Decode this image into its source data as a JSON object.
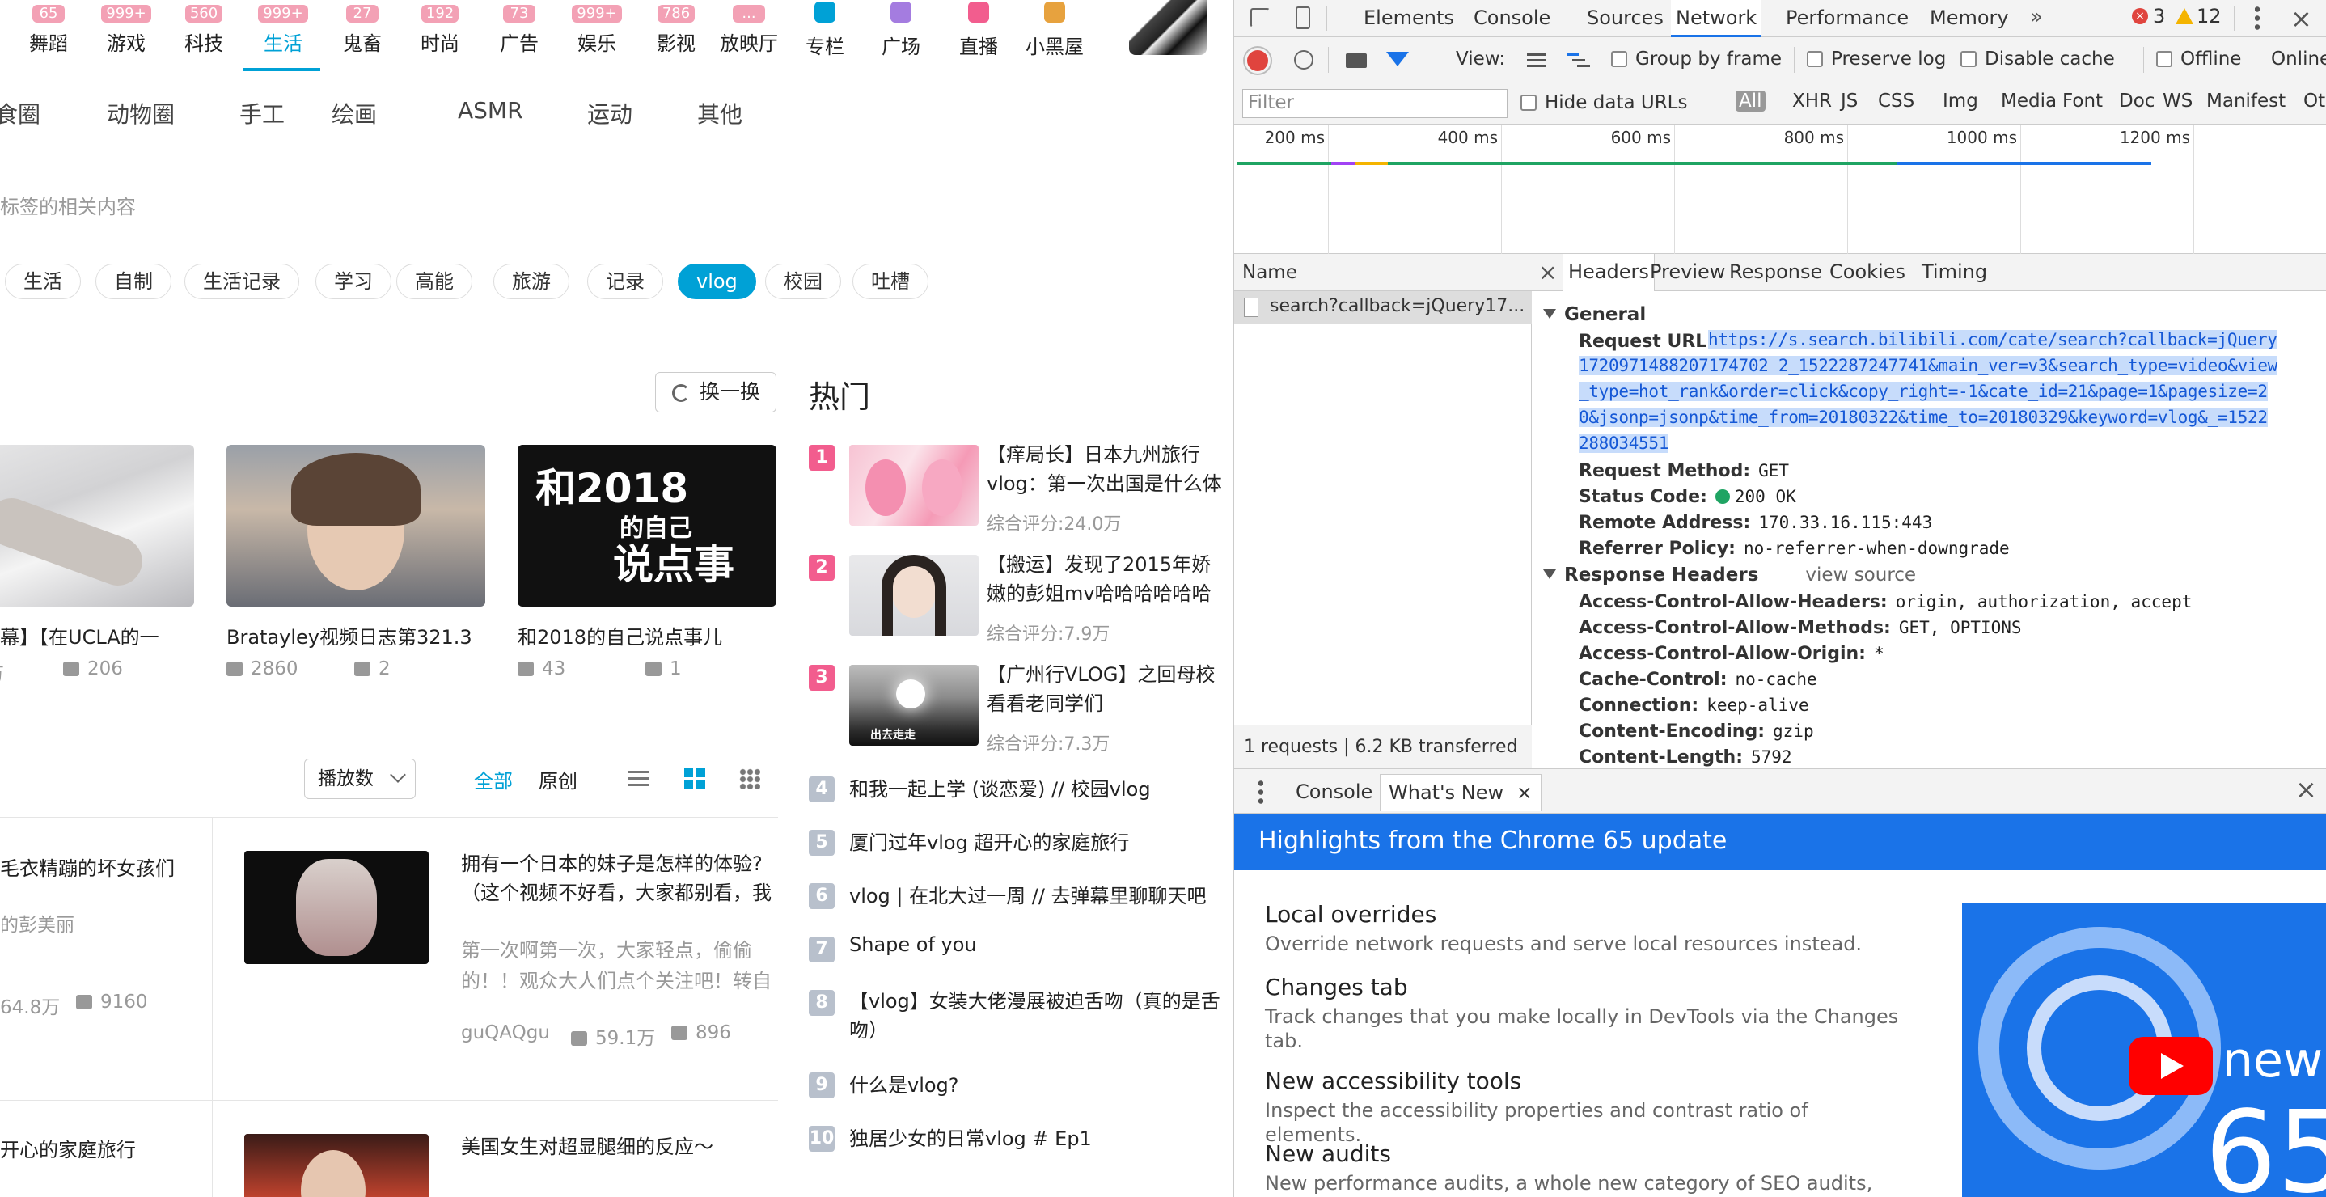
{
  "nav": {
    "items": [
      {
        "count": "65",
        "label": "舞蹈"
      },
      {
        "count": "999+",
        "label": "游戏"
      },
      {
        "count": "560",
        "label": "科技"
      },
      {
        "count": "999+",
        "label": "生活",
        "active": true
      },
      {
        "count": "27",
        "label": "鬼畜"
      },
      {
        "count": "192",
        "label": "时尚"
      },
      {
        "count": "73",
        "label": "广告"
      },
      {
        "count": "999+",
        "label": "娱乐"
      },
      {
        "count": "786",
        "label": "影视"
      },
      {
        "count": "...",
        "label": "放映厅"
      }
    ],
    "icon_items": [
      {
        "label": "专栏",
        "icon": "column-icon",
        "color": "#00a1d6"
      },
      {
        "label": "广场",
        "icon": "square-icon",
        "color": "#a47ce0"
      },
      {
        "label": "直播",
        "icon": "live-icon",
        "color": "#f25d8e"
      },
      {
        "label": "小黑屋",
        "icon": "blackroom-icon",
        "color": "#e7a23e"
      }
    ]
  },
  "subcategories": [
    "食圈",
    "动物圈",
    "手工",
    "绘画",
    "ASMR",
    "运动",
    "其他"
  ],
  "tag_note": "标签的相关内容",
  "tags": [
    {
      "label": "生活"
    },
    {
      "label": "自制"
    },
    {
      "label": "生活记录"
    },
    {
      "label": "学习"
    },
    {
      "label": "高能"
    },
    {
      "label": "旅游"
    },
    {
      "label": "记录"
    },
    {
      "label": "vlog",
      "active": true
    },
    {
      "label": "校园"
    },
    {
      "label": "吐槽"
    }
  ],
  "refresh_label": "换一换",
  "cards": [
    {
      "title": "字幕】【在UCLA的一",
      "plays": "万",
      "danmaku": "206"
    },
    {
      "title": "Bratayley视频日志第321.3",
      "plays": "2860",
      "danmaku": "2"
    },
    {
      "title": "和2018的自己说点事儿",
      "plays": "43",
      "danmaku": "1",
      "thumb_lines": [
        "和2018",
        "的自己",
        "说点事"
      ]
    }
  ],
  "hot": {
    "title": "热门",
    "score_label": "综合评分:",
    "top": [
      {
        "rank": "1",
        "title": "【痒局长】日本九州旅行vlog：第一次出国是什么体",
        "score": "24.0万"
      },
      {
        "rank": "2",
        "title": "【搬运】发现了2015年娇嫩的彭姐mv哈哈哈哈哈哈",
        "score": "7.9万"
      },
      {
        "rank": "3",
        "title": "【广州行VLOG】之回母校看看老同学们",
        "score": "7.3万",
        "thumb_caption": "出去走走"
      }
    ],
    "rest": [
      {
        "rank": "4",
        "title": "和我一起上学 (谈恋爱) // 校园vlog"
      },
      {
        "rank": "5",
        "title": "厦门过年vlog 超开心的家庭旅行"
      },
      {
        "rank": "6",
        "title": "vlog | 在北大过一周 // 去弹幕里聊聊天吧"
      },
      {
        "rank": "7",
        "title": "Shape of you"
      },
      {
        "rank": "8",
        "title": "【vlog】女装大佬漫展被迫舌吻（真的是舌吻）"
      },
      {
        "rank": "9",
        "title": "什么是vlog?"
      },
      {
        "rank": "10",
        "title": "独居少女的日常vlog # Ep1"
      }
    ]
  },
  "sort": {
    "select": "播放数",
    "all": "全部",
    "original": "原创"
  },
  "list": [
    {
      "left_title": "毛衣精蹦的坏女孩们",
      "left_author": "的彭美丽",
      "left_plays": "64.8万",
      "left_danmaku": "9160",
      "title": "拥有一个日本的妹子是怎样的体验?（这个视频不好看，大家都别看，我",
      "desc": "第一次啊第一次，大家轻点，偷偷的！！观众大人们点个关注吧！转自",
      "author": "guQAQgu",
      "plays": "59.1万",
      "danmaku": "896"
    },
    {
      "left_title": "开心的家庭旅行",
      "title": "美国女生对超显腿细的反应～"
    }
  ],
  "devtools": {
    "tabs": [
      "Elements",
      "Console",
      "Sources",
      "Network",
      "Performance",
      "Memory"
    ],
    "active_tab": "Network",
    "errors": "3",
    "warnings": "12",
    "toolbar": {
      "view_label": "View:",
      "group_by_frame": "Group by frame",
      "preserve_log": "Preserve log",
      "disable_cache": "Disable cache",
      "offline": "Offline",
      "online": "Online"
    },
    "filter": {
      "placeholder": "Filter",
      "hide_data_urls": "Hide data URLs",
      "types": [
        "All",
        "XHR",
        "JS",
        "CSS",
        "Img",
        "Media",
        "Font",
        "Doc",
        "WS",
        "Manifest",
        "Other"
      ]
    },
    "timeline": [
      "200 ms",
      "400 ms",
      "600 ms",
      "800 ms",
      "1000 ms",
      "1200 ms"
    ],
    "name_header": "Name",
    "request_name": "search?callback=jQuery17...",
    "summary": "1 requests | 6.2 KB transferred",
    "detail_tabs": [
      "Headers",
      "Preview",
      "Response",
      "Cookies",
      "Timing"
    ],
    "general_title": "General",
    "request_url_label": "Request URL:",
    "request_url": "https://s.search.bilibili.com/cate/search?callback=jQuery1720971488207174702 2_1522287247741&main_ver=v3&search_type=video&view_type=hot_rank&order=click&copy_right=-1&cate_id=21&page=1&pagesize=20&jsonp=jsonp&time_from=20180322&time_to=20180329&keyword=vlog&_=1522288034551",
    "url_lines": [
      "https://s.search.bilibili.com/cate/search?callback=jQuery",
      "1720971488207174702 2_1522287247741&main_ver=v3&search_type=video&view",
      "_type=hot_rank&order=click&copy_right=-1&cate_id=21&page=1&pagesize=2",
      "0&jsonp=jsonp&time_from=20180322&time_to=20180329&keyword=vlog&_=1522",
      "288034551"
    ],
    "general": [
      {
        "k": "Request Method:",
        "v": "GET"
      },
      {
        "k": "Status Code:",
        "v": "200 OK"
      },
      {
        "k": "Remote Address:",
        "v": "170.33.16.115:443"
      },
      {
        "k": "Referrer Policy:",
        "v": "no-referrer-when-downgrade"
      }
    ],
    "response_headers_title": "Response Headers",
    "view_source": "view source",
    "response_headers": [
      {
        "k": "Access-Control-Allow-Headers:",
        "v": "origin, authorization, accept"
      },
      {
        "k": "Access-Control-Allow-Methods:",
        "v": "GET, OPTIONS"
      },
      {
        "k": "Access-Control-Allow-Origin:",
        "v": "*"
      },
      {
        "k": "Cache-Control:",
        "v": "no-cache"
      },
      {
        "k": "Connection:",
        "v": "keep-alive"
      },
      {
        "k": "Content-Encoding:",
        "v": "gzip"
      },
      {
        "k": "Content-Length:",
        "v": "5792"
      }
    ],
    "drawer_tabs": [
      "Console",
      "What's New"
    ],
    "whats_new_banner": "Highlights from the Chrome 65 update",
    "whats_new": [
      {
        "title": "Local overrides",
        "desc": "Override network requests and serve local resources instead."
      },
      {
        "title": "Changes tab",
        "desc": "Track changes that you make locally in DevTools via the Changes tab."
      },
      {
        "title": "New accessibility tools",
        "desc": "Inspect the accessibility properties and contrast ratio of elements."
      },
      {
        "title": "New audits",
        "desc": "New performance audits, a whole new category of SEO audits,"
      }
    ],
    "video_text": "new",
    "video_number": "65"
  }
}
